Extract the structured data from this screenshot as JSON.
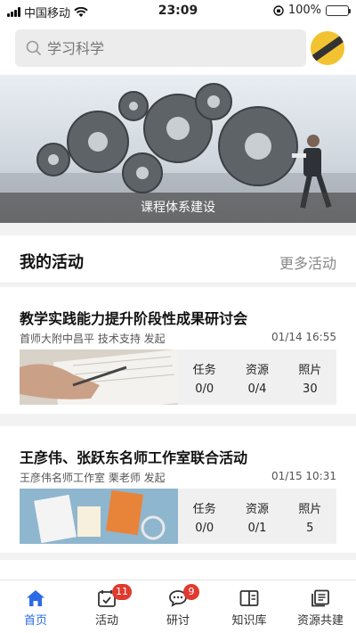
{
  "status_bar": {
    "carrier": "中国移动",
    "time": "23:09",
    "battery": "100%"
  },
  "search": {
    "placeholder": "学习科学"
  },
  "banner": {
    "caption": "课程体系建设"
  },
  "section": {
    "title": "我的活动",
    "more_label": "更多活动"
  },
  "activities": [
    {
      "title": "教学实践能力提升阶段性成果研讨会",
      "subtitle": "首师大附中昌平 技术支持 发起",
      "date": "01/14 16:55",
      "stats": [
        {
          "label": "任务",
          "value": "0/0"
        },
        {
          "label": "资源",
          "value": "0/4"
        },
        {
          "label": "照片",
          "value": "30"
        }
      ]
    },
    {
      "title": "王彦伟、张跃东名师工作室联合活动",
      "subtitle": "王彦伟名师工作室 栗老师 发起",
      "date": "01/15 10:31",
      "stats": [
        {
          "label": "任务",
          "value": "0/0"
        },
        {
          "label": "资源",
          "value": "0/1"
        },
        {
          "label": "照片",
          "value": "5"
        }
      ]
    }
  ],
  "tabs": [
    {
      "label": "首页",
      "icon": "home-icon",
      "active": true
    },
    {
      "label": "活动",
      "icon": "calendar-icon",
      "badge": "11"
    },
    {
      "label": "研讨",
      "icon": "chat-icon",
      "badge": "9"
    },
    {
      "label": "知识库",
      "icon": "book-icon"
    },
    {
      "label": "资源共建",
      "icon": "resource-icon"
    }
  ],
  "colors": {
    "accent": "#2b6be6",
    "badge": "#e03a2f",
    "battery": "#4cd964"
  }
}
